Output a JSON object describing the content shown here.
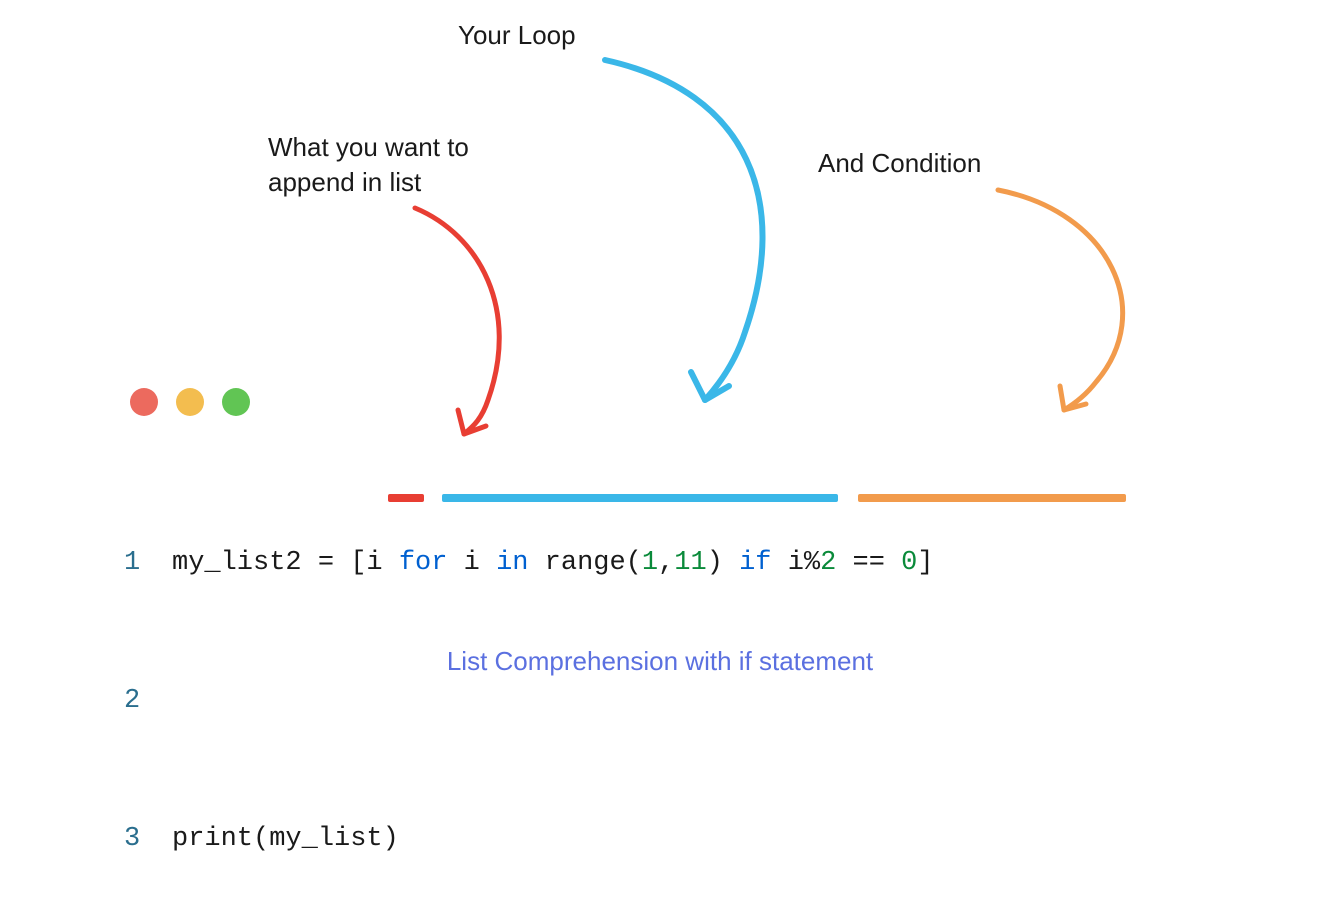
{
  "annotations": {
    "loop": "Your Loop",
    "append_line1": "What you want to",
    "append_line2": "append in list",
    "condition": "And Condition"
  },
  "code": {
    "lines": [
      "1",
      "2",
      "3"
    ],
    "line1": {
      "p1": "my_list2 = [i ",
      "kw_for": "for",
      "p2": " i ",
      "kw_in": "in",
      "p3": " range(",
      "n1": "1",
      "comma": ",",
      "n2": "11",
      "p4": ") ",
      "kw_if": "if",
      "p5": " i%",
      "n3": "2",
      "p6": " == ",
      "n4": "0",
      "p7": "]"
    },
    "line3": "print(my_list)"
  },
  "caption": "List Comprehension with if statement",
  "colors": {
    "red": "#e83e33",
    "blue": "#3ab7e8",
    "orange": "#f29b4c",
    "caption": "#5b70e0"
  }
}
